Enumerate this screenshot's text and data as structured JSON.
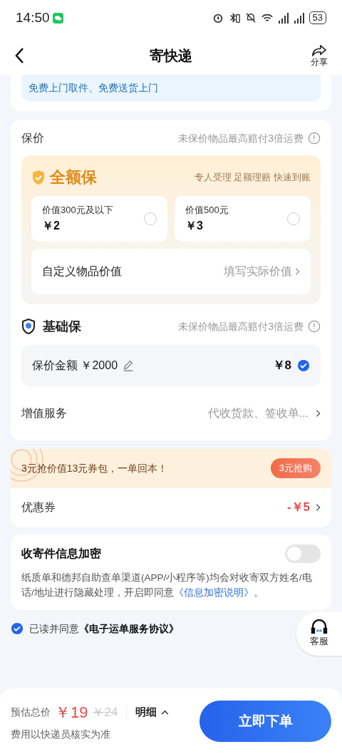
{
  "status_bar": {
    "time": "14:50",
    "battery": "53"
  },
  "header": {
    "title": "寄快递",
    "share": "分享"
  },
  "service_banner": {
    "text": "免费上门取件、免费送货上门"
  },
  "insurance": {
    "label": "保价",
    "note": "未保价物品最高赔付3倍运费",
    "full": {
      "title": "全额保",
      "tagline": "专人受理 足额理赔 快速到账",
      "options": [
        {
          "label": "价值300元及以下",
          "price": "￥2",
          "selected": false
        },
        {
          "label": "价值500元",
          "price": "￥3",
          "selected": false
        }
      ],
      "custom": {
        "label": "自定义物品价值",
        "hint": "填写实际价值"
      }
    },
    "basic": {
      "title": "基础保",
      "note": "未保价物品最高赔付3倍运费",
      "amount": "保价金额 ￥2000",
      "price": "￥8",
      "selected": true
    }
  },
  "value_added": {
    "label": "增值服务",
    "value": "代收货款、签收单..."
  },
  "promo": {
    "text": "3元抢价值13元券包，一单回本！",
    "button": "3元抢购"
  },
  "coupon": {
    "label": "优惠券",
    "value": "-￥5"
  },
  "encryption": {
    "title": "收寄件信息加密",
    "on": false,
    "text": "纸质单和德邦自助查单渠道(APP/小程序等)均会对收寄双方姓名/电话/地址进行隐藏处理，开启即同意",
    "link": "《信息加密说明》",
    "tail": "。"
  },
  "agreement": {
    "checked": true,
    "text": "已读并同意",
    "link": "《电子运单服务协议》"
  },
  "support": {
    "label": "客服"
  },
  "footer": {
    "total_label": "预估总价",
    "price": "￥19",
    "original": "￥24",
    "detail": "明细",
    "note": "费用以快递员核实为准",
    "submit": "立即下单"
  }
}
